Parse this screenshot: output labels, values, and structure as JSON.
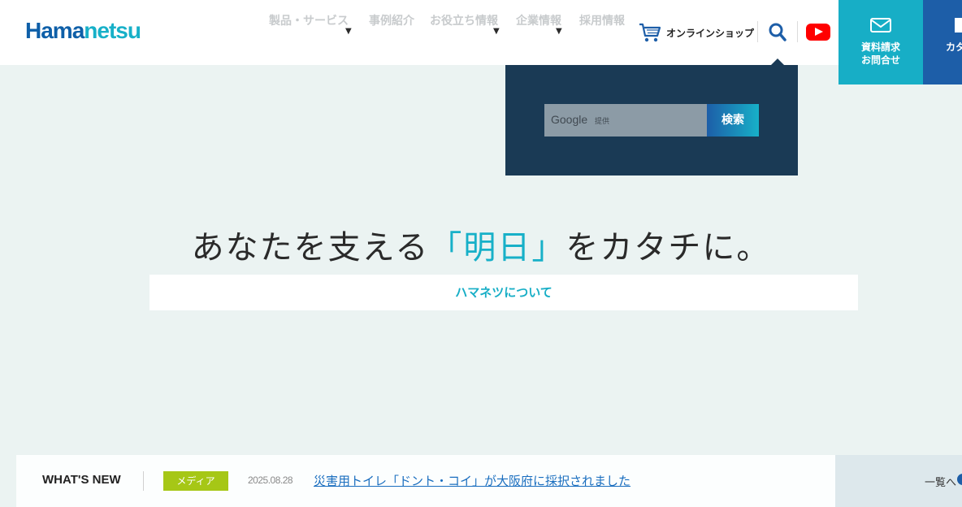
{
  "header": {
    "logo_part1": "Hama",
    "logo_part2": "netsu",
    "nav": [
      {
        "label": "製品・サービス",
        "has_dropdown": true
      },
      {
        "label": "事例紹介",
        "has_dropdown": false
      },
      {
        "label": "お役立ち情報",
        "has_dropdown": true
      },
      {
        "label": "企業情報",
        "has_dropdown": true
      },
      {
        "label": "採用情報",
        "has_dropdown": false
      }
    ],
    "dropdown_caret": "▼",
    "online_shop_label": "オンラインショップ",
    "contact_button_label": "資料請求\nお問合せ",
    "catalog_button_label": "カタ"
  },
  "search": {
    "placeholder_brand": "Google",
    "placeholder_suffix": "提供",
    "submit_label": "検索"
  },
  "hero": {
    "tagline_before": "あなたを支える",
    "tagline_accent": "「明日」",
    "tagline_after": "をカタチに。",
    "about_link_label": "ハマネツについて"
  },
  "news": {
    "section_title": "WHAT'S NEW",
    "item": {
      "category": "メディア",
      "date": "2025.08.28",
      "title": "災害用トイレ「ドント・コイ」が大阪府に採択されました"
    },
    "more_label": "一覧へ"
  },
  "colors": {
    "brand_blue": "#1d5ea8",
    "brand_cyan": "#17b0c8",
    "panel_navy": "#1a3a55",
    "badge_green": "#a6c716",
    "youtube_red": "#ff0000"
  }
}
